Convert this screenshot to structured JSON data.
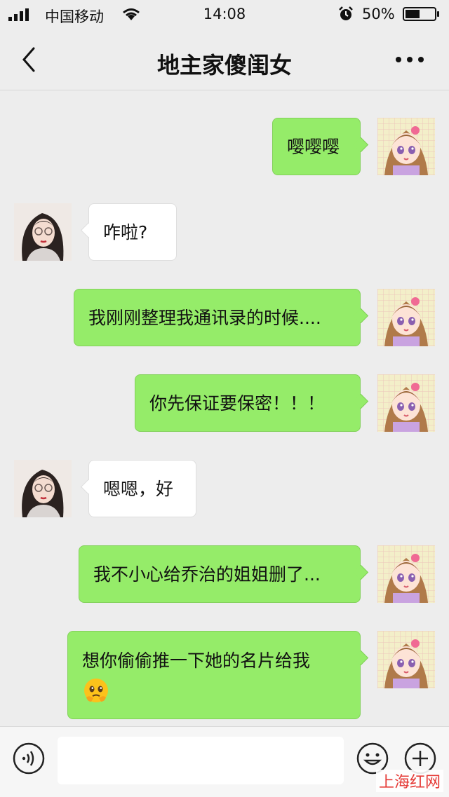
{
  "status_bar": {
    "carrier": "中国移动",
    "time": "14:08",
    "battery_percent": "50%",
    "battery_level": 0.5
  },
  "nav": {
    "title": "地主家傻闺女",
    "back_icon": "chevron-left-icon",
    "more_icon": "more-dots-icon"
  },
  "messages": [
    {
      "side": "out",
      "text": "嘤嘤嘤"
    },
    {
      "side": "in",
      "text": "咋啦?"
    },
    {
      "side": "out",
      "text": "我刚刚整理我通讯录的时候...."
    },
    {
      "side": "out",
      "text": "你先保证要保密！！！"
    },
    {
      "side": "in",
      "text": "嗯嗯，好"
    },
    {
      "side": "out",
      "text": "我不小心给乔治的姐姐删了..."
    },
    {
      "side": "out",
      "text": "想你偷偷推一下她的名片给我",
      "emoji": "pleading-face-emoji"
    }
  ],
  "input_bar": {
    "voice_icon": "voice-icon",
    "emoji_icon": "emoji-icon",
    "plus_icon": "plus-icon",
    "input_value": ""
  },
  "watermark": "上海红网",
  "colors": {
    "background": "#ededed",
    "outgoing_bubble": "#95ec69",
    "incoming_bubble": "#ffffff",
    "watermark": "#e53935"
  }
}
